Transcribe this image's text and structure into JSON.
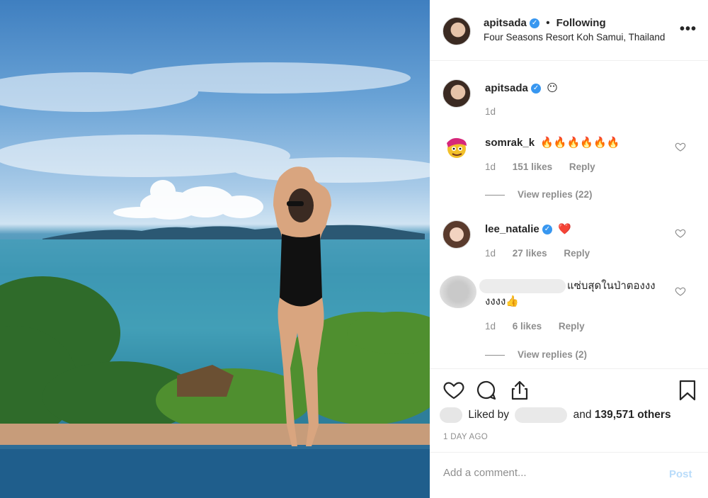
{
  "post": {
    "author": "apitsada",
    "follow_status": "Following",
    "location": "Four Seasons Resort Koh Samui, Thailand",
    "more_icon": "more-horizontal-icon"
  },
  "caption": {
    "user": "apitsada",
    "text": "😶",
    "time": "1d"
  },
  "comments": [
    {
      "user": "somrak_k",
      "text": "🔥🔥🔥🔥🔥🔥",
      "time": "1d",
      "likes": "151 likes",
      "reply_label": "Reply",
      "view_replies": "View replies (22)"
    },
    {
      "user": "lee_natalie",
      "text": "❤️",
      "time": "1d",
      "likes": "27 likes",
      "reply_label": "Reply"
    },
    {
      "user": "",
      "text_line1": "แซ่บสุดในป่าตองงง",
      "text_line2": "งงงง👍",
      "time": "1d",
      "likes": "6 likes",
      "reply_label": "Reply",
      "view_replies": "View replies (2)"
    }
  ],
  "engagement": {
    "liked_by_prefix": "Liked by",
    "liked_by_suffix": "and",
    "others": "139,571 others",
    "timestamp": "1 DAY AGO"
  },
  "add_comment": {
    "placeholder": "Add a comment...",
    "post_label": "Post"
  },
  "colors": {
    "verified": "#3897f0",
    "post_disabled": "#b9dcfa",
    "muted": "#8e8e8e"
  }
}
